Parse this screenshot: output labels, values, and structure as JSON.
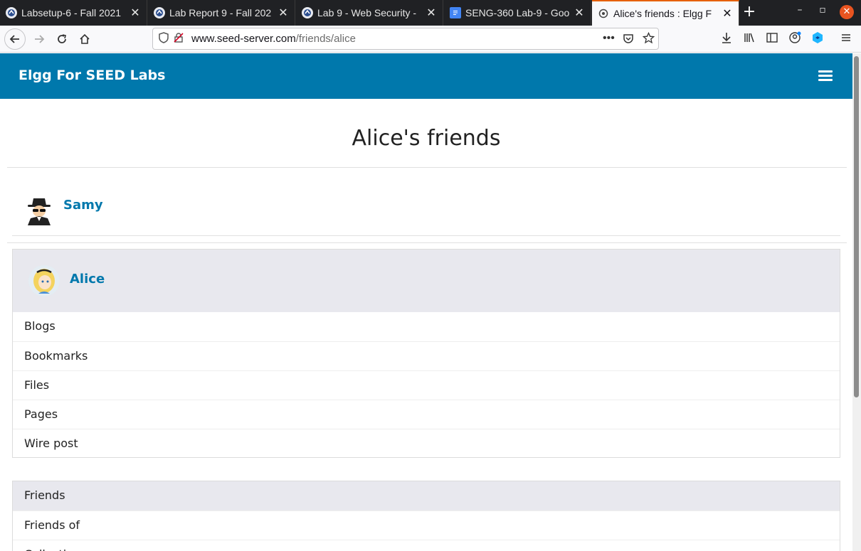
{
  "browser": {
    "tabs": [
      {
        "title": "Labsetup-6 - Fall 2021",
        "favicon": "seed-icon",
        "active": false
      },
      {
        "title": "Lab Report 9 - Fall 202",
        "favicon": "seed-icon",
        "active": false
      },
      {
        "title": "Lab 9 - Web Security -",
        "favicon": "seed-icon",
        "active": false
      },
      {
        "title": "SENG-360 Lab-9 - Goo",
        "favicon": "docs-icon",
        "active": false
      },
      {
        "title": "Alice's friends : Elgg F",
        "favicon": "elgg-icon",
        "active": true
      }
    ],
    "url_host": "www.seed-server.com",
    "url_path": "/friends/alice"
  },
  "site": {
    "name": "Elgg For SEED Labs"
  },
  "page": {
    "title": "Alice's friends",
    "friends": [
      {
        "name": "Samy"
      }
    ]
  },
  "owner": {
    "name": "Alice",
    "menu": [
      "Blogs",
      "Bookmarks",
      "Files",
      "Pages",
      "Wire post"
    ]
  },
  "friends_menu": [
    "Friends",
    "Friends of",
    "Collections"
  ],
  "colors": {
    "brand": "#0078ac",
    "panel": "#e8e8ee"
  }
}
